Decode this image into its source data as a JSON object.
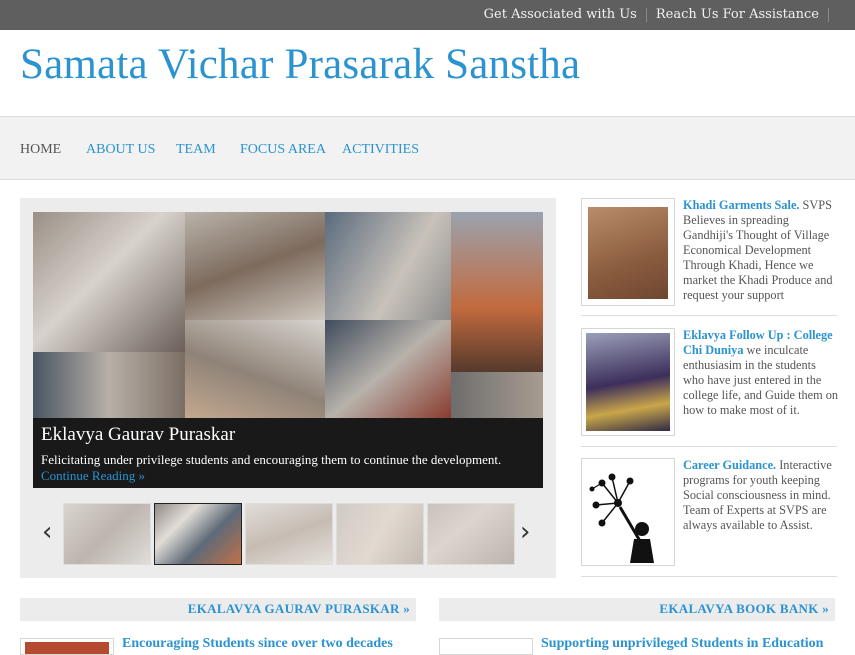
{
  "topbar": {
    "links": [
      "Get Associated with Us",
      "Reach Us For Assistance"
    ]
  },
  "header": {
    "title": "Samata Vichar Prasarak Sanstha"
  },
  "nav": {
    "items": [
      "HOME",
      "ABOUT US",
      "TEAM",
      "FOCUS AREA",
      "ACTIVITIES"
    ]
  },
  "slider": {
    "caption_title": "Eklavya Gaurav Puraskar",
    "caption_text": "Felicitating under privilege students and encouraging them to continue the development.",
    "continue_label": "Continue Reading »",
    "prev_glyph": "‹",
    "next_glyph": "›"
  },
  "sidebar": {
    "items": [
      {
        "title": "Khadi Garments Sale.",
        "text": " SVPS Believes in spreading Gandhiji's Thought of Village Economical Development Through Khadi, Hence we market the Khadi Produce and request your support"
      },
      {
        "title": "Eklavya Follow Up : College Chi Duniya",
        "text": " we inculcate enthusiasim in the students who have just entered in the college life, and Guide them on how to make most of it."
      },
      {
        "title": "Career Guidance.",
        "text": " Interactive programs for youth keeping Social consciousness in mind. Team of Experts at SVPS are always available to Assist."
      }
    ]
  },
  "bottom": {
    "left_bar": "EKALAVYA GAURAV PURASKAR »",
    "right_bar": "EKALAVYA BOOK BANK »",
    "left_link": "Encouraging Students since over two decades",
    "right_link": "Supporting unprivileged Students in Education"
  },
  "colors": {
    "accent": "#2b93d0",
    "topbar": "#5f5f5f",
    "nav_bg": "#f2f2f2"
  }
}
